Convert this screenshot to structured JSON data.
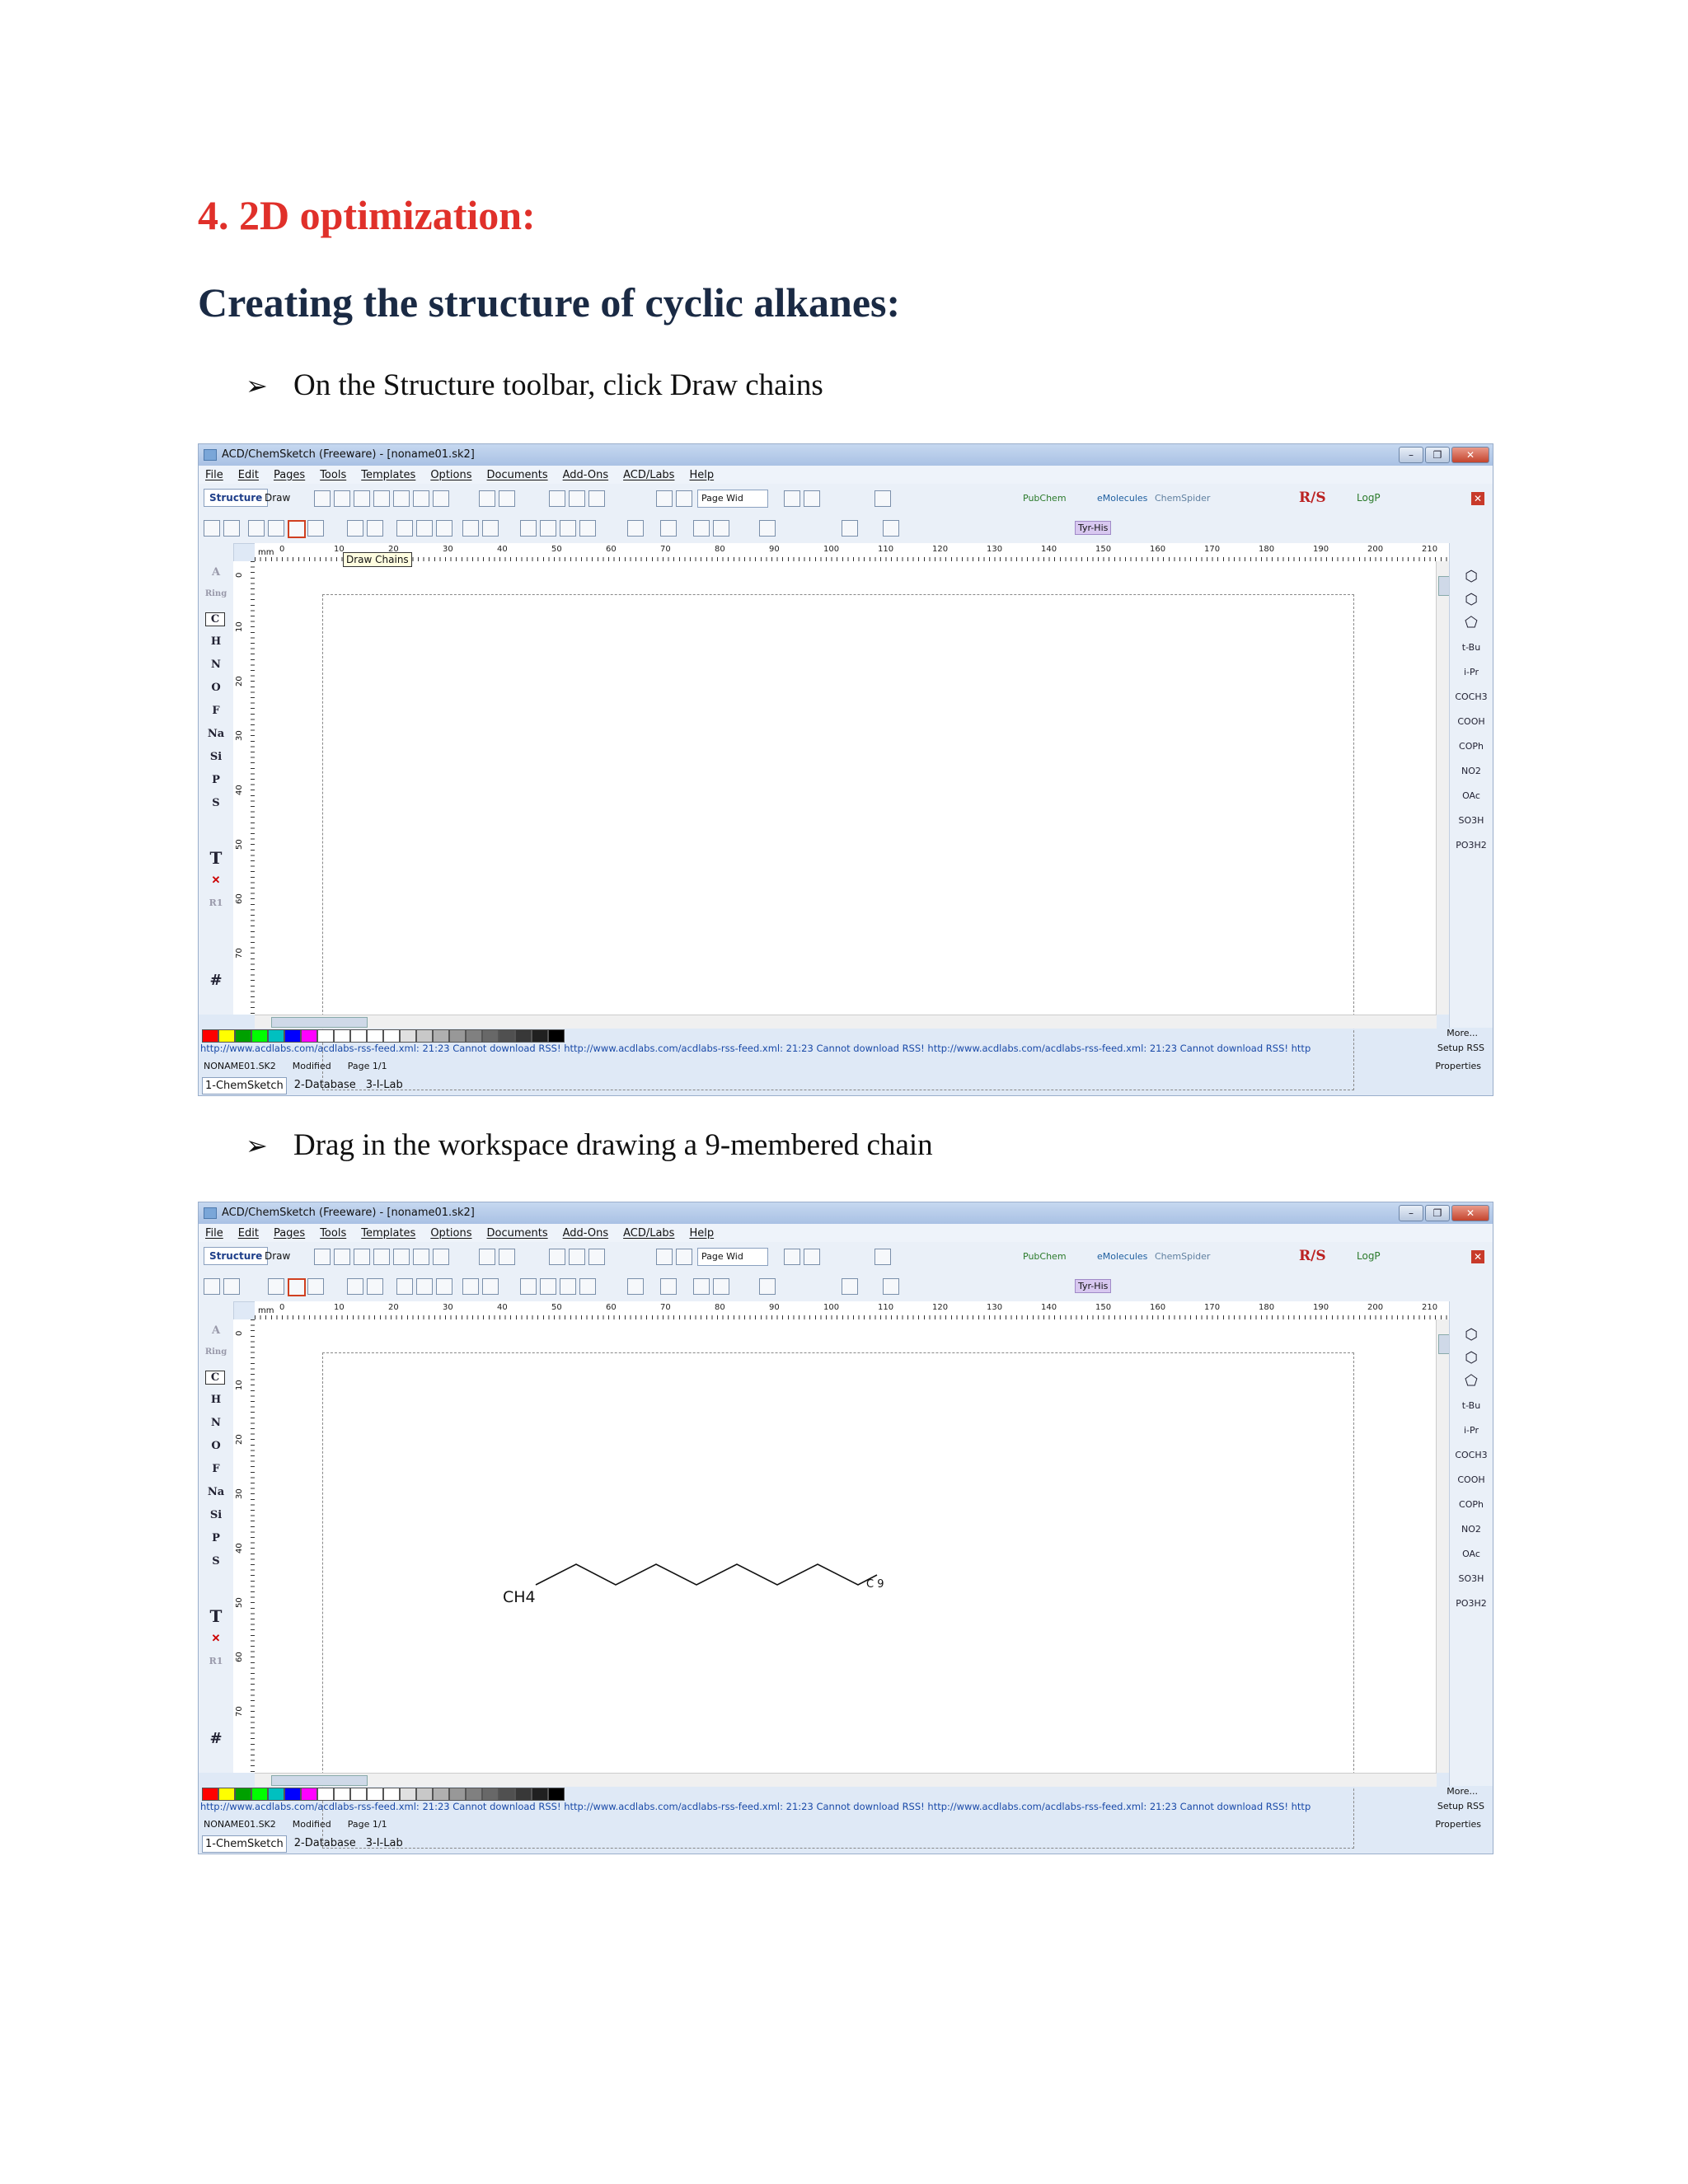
{
  "doc": {
    "heading1": "4. 2D optimization:",
    "heading2": "Creating the structure of cyclic alkanes:",
    "bullet_glyph": "➢",
    "bullet1": "On the Structure toolbar, click Draw chains",
    "bullet2": "Drag in the workspace drawing a 9-membered chain"
  },
  "app": {
    "title": "ACD/ChemSketch (Freeware) - [noname01.sk2]",
    "menus": [
      "File",
      "Edit",
      "Pages",
      "Tools",
      "Templates",
      "Options",
      "Documents",
      "Add-Ons",
      "ACD/Labs",
      "Help"
    ],
    "tab_structure": "Structure",
    "tab_draw": "Draw",
    "page_zoom": "Page Wid",
    "pubchem": "PubChem",
    "emolecules": "eMolecules",
    "chemspider": "ChemSpider",
    "rs_label": "R/S",
    "logp_label": "LogP",
    "tyrhis": "Tyr-His",
    "ruler_unit": "mm",
    "ruler_h": [
      "0",
      "10",
      "20",
      "30",
      "40",
      "50",
      "60",
      "70",
      "80",
      "90",
      "100",
      "110",
      "120",
      "130",
      "140",
      "150",
      "160",
      "170",
      "180",
      "190",
      "200",
      "210",
      "2"
    ],
    "ruler_v": [
      "0",
      "10",
      "20",
      "30",
      "40",
      "50",
      "60",
      "70"
    ],
    "elements": [
      "A",
      "Ring",
      "C",
      "H",
      "N",
      "O",
      "F",
      "Na",
      "Si",
      "P",
      "S",
      "T",
      "R1",
      "#"
    ],
    "groups": [
      "t-Bu",
      "i-Pr",
      "COCH3",
      "COOH",
      "COPh",
      "NO2",
      "OAc",
      "SO3H",
      "PO3H2"
    ],
    "more": "More...",
    "rss": "http://www.acdlabs.com/acdlabs-rss-feed.xml: 21:23 Cannot download RSS! http://www.acdlabs.com/acdlabs-rss-feed.xml: 21:23 Cannot download RSS! http://www.acdlabs.com/acdlabs-rss-feed.xml: 21:23 Cannot download RSS! http",
    "setup_rss": "Setup RSS",
    "status_file": "NONAME01.SK2",
    "status_mod": "Modified",
    "status_page": "Page 1/1",
    "properties": "Properties",
    "bottom_tabs": [
      "1-ChemSketch",
      "2-Database",
      "3-I-Lab"
    ],
    "palette": [
      "#ff0000",
      "#ffff00",
      "#00a000",
      "#00ff00",
      "#00c0c0",
      "#0000ff",
      "#ff00ff",
      "#ffffff",
      "#ffffff",
      "#ffffff",
      "#ffffff",
      "#ffffff",
      "#e0e0e0",
      "#c8c8c8",
      "#b0b0b0",
      "#989898",
      "#808080",
      "#686868",
      "#505050",
      "#383838",
      "#202020",
      "#000000"
    ]
  },
  "shot1": {
    "tooltip": "Draw Chains"
  },
  "shot2": {
    "ch4": "CH4",
    "c9": "C  9"
  }
}
